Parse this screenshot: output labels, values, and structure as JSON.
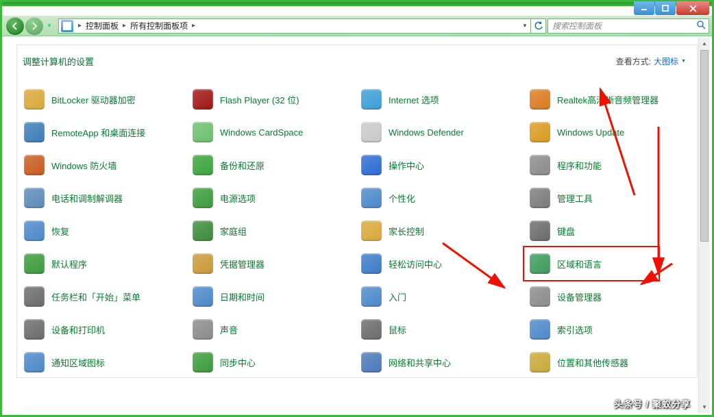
{
  "window": {
    "breadcrumb": [
      "控制面板",
      "所有控制面板项"
    ],
    "search_placeholder": "搜索控制面板"
  },
  "page": {
    "title": "调整计算机的设置",
    "view_label": "查看方式:",
    "view_value": "大图标"
  },
  "items": [
    {
      "label": "BitLocker 驱动器加密",
      "icon": "bitlocker-icon",
      "color": "#d8a838"
    },
    {
      "label": "Flash Player (32 位)",
      "icon": "flash-icon",
      "color": "#a01414"
    },
    {
      "label": "Internet 选项",
      "icon": "internet-options-icon",
      "color": "#3b9dd6"
    },
    {
      "label": "Realtek高清晰音频管理器",
      "icon": "realtek-icon",
      "color": "#d87a1e"
    },
    {
      "label": "RemoteApp 和桌面连接",
      "icon": "remoteapp-icon",
      "color": "#3b7bb7"
    },
    {
      "label": "Windows CardSpace",
      "icon": "cardspace-icon",
      "color": "#6bbf6b"
    },
    {
      "label": "Windows Defender",
      "icon": "defender-icon",
      "color": "#c8c8c8"
    },
    {
      "label": "Windows Update",
      "icon": "windows-update-icon",
      "color": "#d89a1e"
    },
    {
      "label": "Windows 防火墙",
      "icon": "firewall-icon",
      "color": "#c85a1e"
    },
    {
      "label": "备份和还原",
      "icon": "backup-icon",
      "color": "#3aa33a"
    },
    {
      "label": "操作中心",
      "icon": "action-center-icon",
      "color": "#2a6ad2"
    },
    {
      "label": "程序和功能",
      "icon": "programs-icon",
      "color": "#8a8a8a"
    },
    {
      "label": "电话和调制解调器",
      "icon": "phone-modem-icon",
      "color": "#5a8ab8"
    },
    {
      "label": "电源选项",
      "icon": "power-options-icon",
      "color": "#3a9a3a"
    },
    {
      "label": "个性化",
      "icon": "personalization-icon",
      "color": "#4a88c8"
    },
    {
      "label": "管理工具",
      "icon": "admin-tools-icon",
      "color": "#7a7a7a"
    },
    {
      "label": "恢复",
      "icon": "recovery-icon",
      "color": "#4a88c8"
    },
    {
      "label": "家庭组",
      "icon": "homegroup-icon",
      "color": "#3a8a3a"
    },
    {
      "label": "家长控制",
      "icon": "parental-controls-icon",
      "color": "#d8a838"
    },
    {
      "label": "键盘",
      "icon": "keyboard-icon",
      "color": "#6a6a6a"
    },
    {
      "label": "默认程序",
      "icon": "default-programs-icon",
      "color": "#3a9a3a"
    },
    {
      "label": "凭据管理器",
      "icon": "credentials-icon",
      "color": "#c89838"
    },
    {
      "label": "轻松访问中心",
      "icon": "ease-of-access-icon",
      "color": "#3a7ac8"
    },
    {
      "label": "区域和语言",
      "icon": "region-language-icon",
      "color": "#3a9a5a"
    },
    {
      "label": "任务栏和「开始」菜单",
      "icon": "taskbar-icon",
      "color": "#6a6a6a"
    },
    {
      "label": "日期和时间",
      "icon": "datetime-icon",
      "color": "#4a88c8"
    },
    {
      "label": "入门",
      "icon": "getting-started-icon",
      "color": "#4a88c8"
    },
    {
      "label": "设备管理器",
      "icon": "device-manager-icon",
      "color": "#8a8a8a"
    },
    {
      "label": "设备和打印机",
      "icon": "devices-printers-icon",
      "color": "#6a6a6a"
    },
    {
      "label": "声音",
      "icon": "sound-icon",
      "color": "#8a8a8a"
    },
    {
      "label": "鼠标",
      "icon": "mouse-icon",
      "color": "#6a6a6a"
    },
    {
      "label": "索引选项",
      "icon": "indexing-icon",
      "color": "#4a88c8"
    },
    {
      "label": "通知区域图标",
      "icon": "notification-icons-icon",
      "color": "#4a88c8"
    },
    {
      "label": "同步中心",
      "icon": "sync-center-icon",
      "color": "#3a9a3a"
    },
    {
      "label": "网络和共享中心",
      "icon": "network-sharing-icon",
      "color": "#4a78b8"
    },
    {
      "label": "位置和其他传感器",
      "icon": "location-sensors-icon",
      "color": "#c8a838"
    }
  ],
  "annotations": {
    "highlight_item": "区域和语言",
    "watermark": "头条号 / 聚蚁分享"
  }
}
